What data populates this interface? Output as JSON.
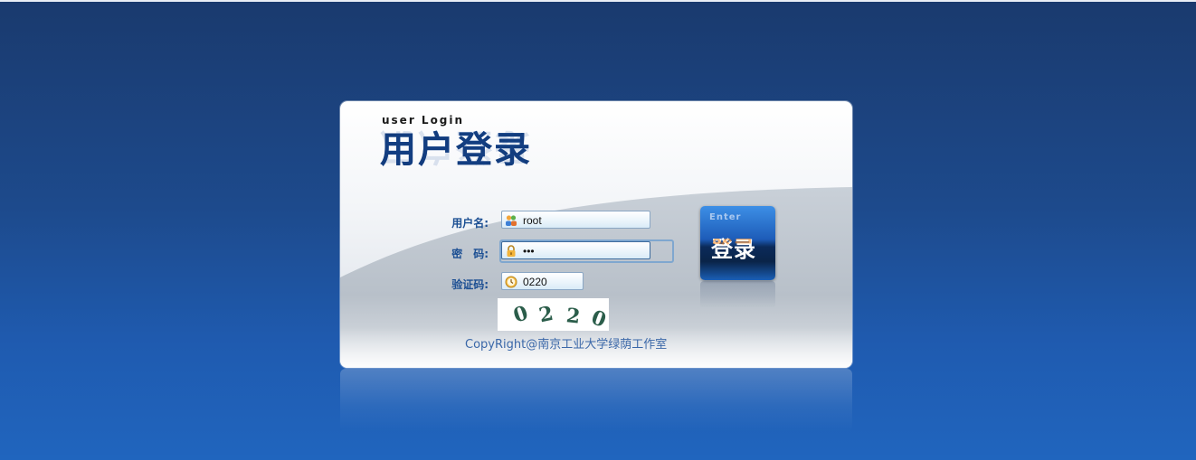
{
  "header": {
    "subtitle": "user Login",
    "title": "用户登录"
  },
  "form": {
    "username": {
      "label": "用户名:",
      "value": "root",
      "icon": "users-icon"
    },
    "password": {
      "label": "密　码:",
      "value": "•••",
      "icon": "lock-icon"
    },
    "captcha": {
      "label": "验证码:",
      "value": "0220",
      "icon": "clock-icon"
    }
  },
  "captcha_image": {
    "digits": [
      "0",
      "2",
      "2",
      "0"
    ]
  },
  "enter_button": {
    "en_label": "Enter",
    "cn_label": "登录"
  },
  "footer": {
    "copyright": "CopyRight@南京工业大学绿荫工作室"
  },
  "colors": {
    "accent": "#1c4f93",
    "background": "#1d4a8c",
    "button": "#1d5cb8"
  }
}
